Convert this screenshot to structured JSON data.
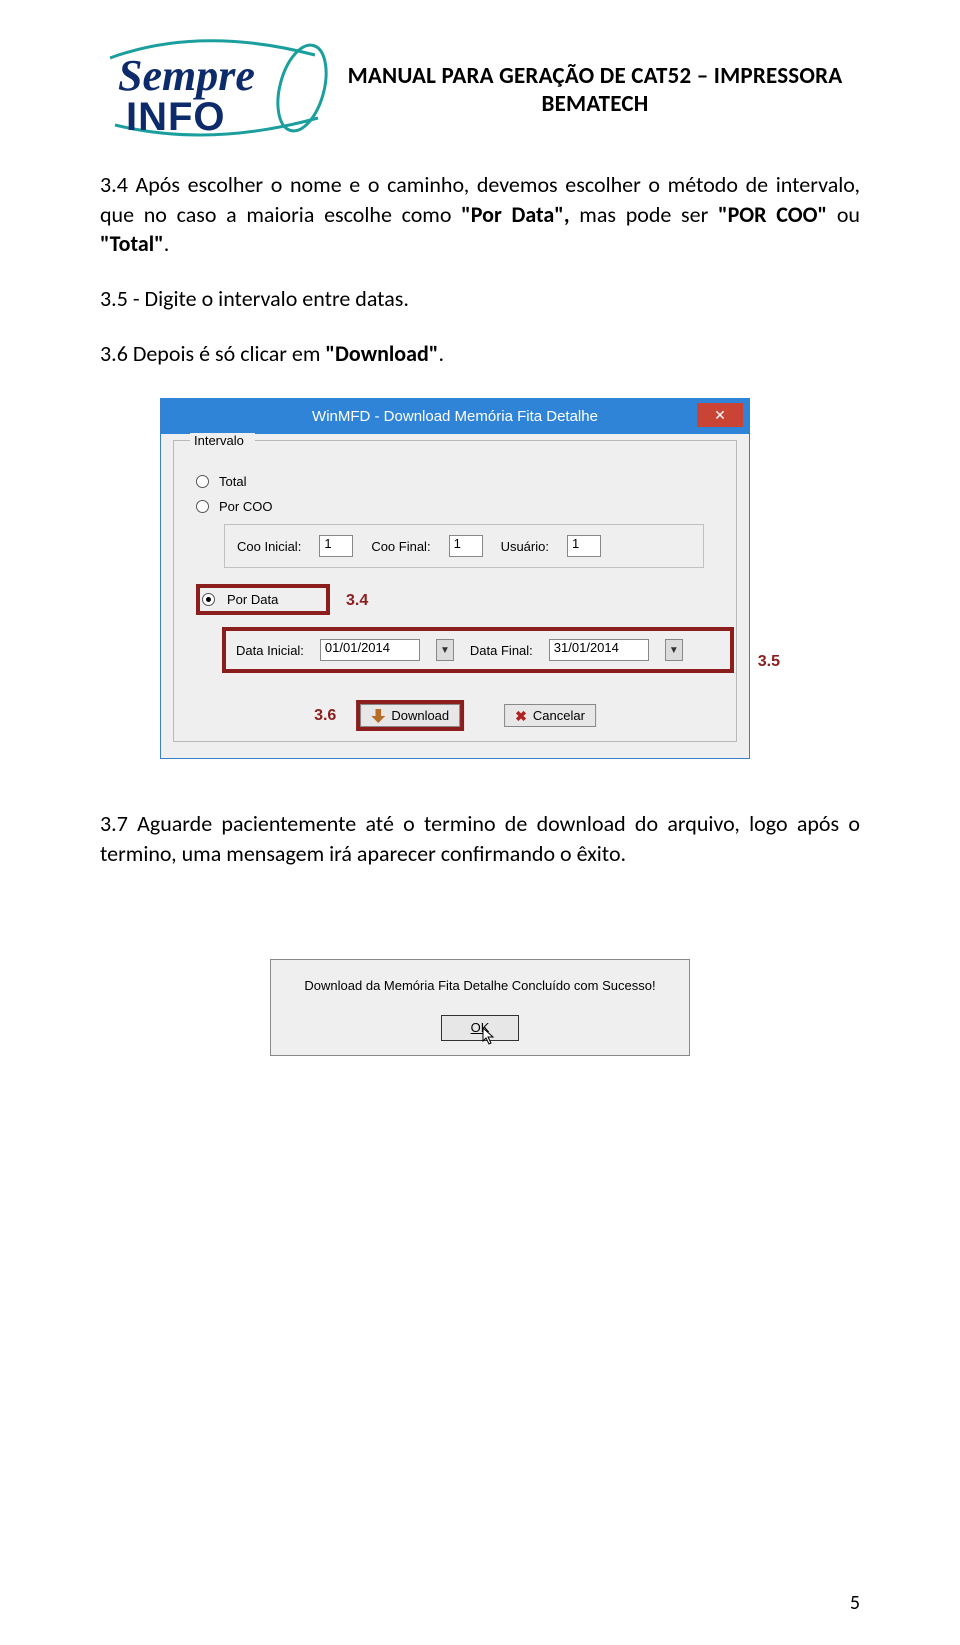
{
  "header": {
    "title_line1": "MANUAL PARA GERAÇÃO DE CAT52 – IMPRESSORA",
    "title_line2": "BEMATECH"
  },
  "logo": {
    "top_word": "Sempre",
    "bottom_word": "INFO"
  },
  "paragraphs": {
    "p34_pre": "3.4 Após escolher o nome e o caminho, devemos escolher o método de intervalo, que no caso a maioria escolhe como ",
    "p34_bold1": "\"Por Data\", ",
    "p34_mid": "mas pode ser ",
    "p34_bold2": "\"POR COO\" ",
    "p34_mid2": "ou ",
    "p34_bold3": "\"Total\"",
    "p34_end": ".",
    "p35": "3.5 - Digite o intervalo entre datas.",
    "p36_pre": "3.6 Depois é só clicar em ",
    "p36_bold": "\"Download\"",
    "p36_end": ".",
    "p37": "3.7 Aguarde pacientemente até o termino de download do arquivo, logo após o termino, uma mensagem irá aparecer confirmando o êxito."
  },
  "dlg": {
    "title": "WinMFD - Download Memória Fita Detalhe",
    "close": "✕",
    "legend": "Intervalo",
    "radio_total": "Total",
    "radio_coo": "Por COO",
    "radio_data": "Por Data",
    "coo_inicial_lbl": "Coo Inicial:",
    "coo_inicial_val": "1",
    "coo_final_lbl": "Coo Final:",
    "coo_final_val": "1",
    "usuario_lbl": "Usuário:",
    "usuario_val": "1",
    "data_inicial_lbl": "Data Inicial:",
    "data_inicial_val": "01/01/2014",
    "data_final_lbl": "Data Final:",
    "data_final_val": "31/01/2014",
    "dd": "▼",
    "btn_download": "Download",
    "btn_cancel": "Cancelar",
    "ann34": "3.4",
    "ann35": "3.5",
    "ann36": "3.6"
  },
  "msgbox": {
    "text": "Download da Memória Fita Detalhe Concluído com Sucesso!",
    "ok": "OK",
    "cursor": "↖"
  },
  "page_number": "5"
}
